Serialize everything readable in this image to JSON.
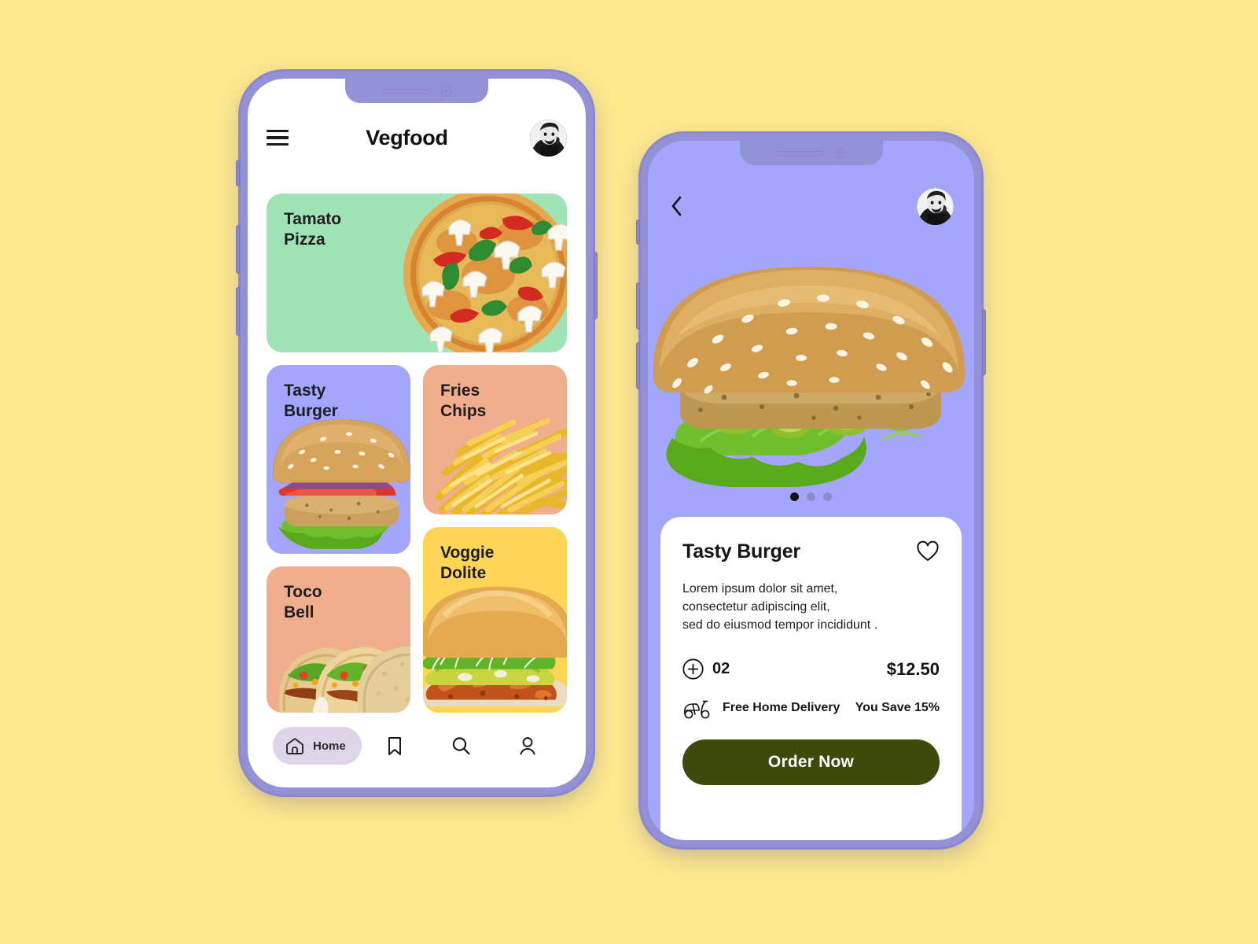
{
  "canvas": {
    "background_color": "#FDE98E"
  },
  "phone_one": {
    "header": {
      "menu_icon": "hamburger-menu-icon",
      "title": "Vegfood",
      "avatar": "user-avatar"
    },
    "cards": [
      {
        "title": "Tamato\nPizza",
        "color": "#9FE3B7",
        "image": "pizza-photo"
      },
      {
        "title": "Tasty\nBurger",
        "color": "#A4A6FD",
        "image": "burger-photo"
      },
      {
        "title": "Fries\nChips",
        "color": "#F1AE8E",
        "image": "fries-photo"
      },
      {
        "title": "Toco\nBell",
        "color": "#F1AE8E",
        "image": "tacos-photo"
      },
      {
        "title": "Voggie\nDolite",
        "color": "#FED557",
        "image": "veggie-burger-photo"
      }
    ],
    "tabbar": {
      "home_label": "Home",
      "items": [
        "home-icon",
        "bookmark-icon",
        "search-icon",
        "profile-icon"
      ],
      "active_pill_color": "#DED5E9"
    }
  },
  "phone_two": {
    "screen_color": "#A4A6FD",
    "header": {
      "back_icon": "chevron-left-icon",
      "avatar": "user-avatar"
    },
    "hero": {
      "image": "tasty-burger-photo",
      "dots_total": 3,
      "dots_active_index": 0
    },
    "detail": {
      "title": "Tasty Burger",
      "favorite_icon": "heart-outline-icon",
      "description": "Lorem ipsum dolor sit amet,\nconsectetur adipiscing elit,\nsed do eiusmod tempor incididunt .",
      "quantity": "02",
      "quantity_add_icon": "plus-circle-icon",
      "price": "$12.50",
      "delivery_icon": "scooter-icon",
      "delivery_label": "Free Home Delivery",
      "savings_label": "You Save 15%",
      "order_button_label": "Order Now",
      "order_button_color": "#3C4A0C"
    }
  }
}
